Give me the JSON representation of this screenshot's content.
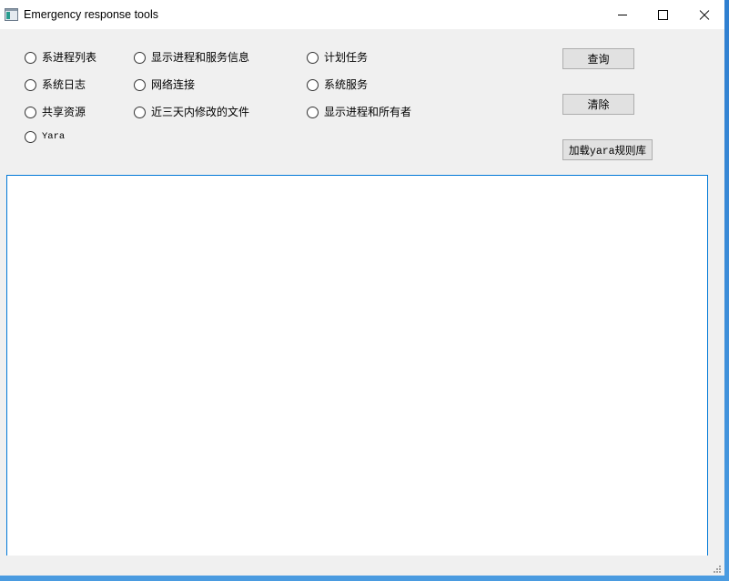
{
  "window": {
    "title": "Emergency response tools",
    "app_icon": "app-window-icon",
    "controls": [
      "minimize-icon",
      "maximize-icon",
      "close-icon"
    ]
  },
  "options": [
    {
      "label": "系进程列表",
      "selected": false
    },
    {
      "label": "显示进程和服务信息",
      "selected": false
    },
    {
      "label": "计划任务",
      "selected": false
    },
    {
      "label": "系统日志",
      "selected": false
    },
    {
      "label": "网络连接",
      "selected": false
    },
    {
      "label": "系统服务",
      "selected": false
    },
    {
      "label": "共享资源",
      "selected": false
    },
    {
      "label": "近三天内修改的文件",
      "selected": false
    },
    {
      "label": "显示进程和所有者",
      "selected": false
    },
    {
      "label": "Yara",
      "selected": false
    }
  ],
  "buttons": {
    "query": "查询",
    "clear": "清除",
    "load_yara": "加载yara规则库"
  },
  "output": {
    "text": ""
  },
  "colors": {
    "window_bg": "#f0f0f0",
    "titlebar_bg": "#ffffff",
    "output_border": "#0078d7",
    "button_bg": "#e1e1e1",
    "button_border": "#adadad"
  }
}
